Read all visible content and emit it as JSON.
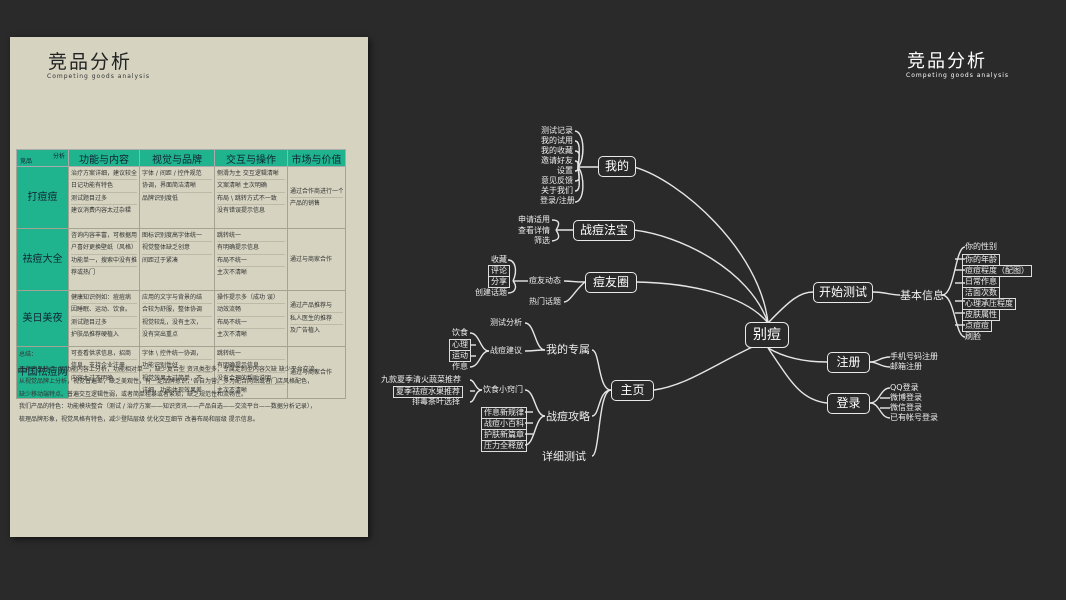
{
  "doc": {
    "title": "竞品分析",
    "subtitle": "Competing goods analysis",
    "table": {
      "corner_top": "分析",
      "corner_bottom": "竞品",
      "headers": [
        "功能与内容",
        "视觉与品牌",
        "交互与操作",
        "市场与价值"
      ],
      "rows": [
        {
          "name": "打痘痘",
          "c1": [
            "治疗方案详细，建议较全",
            "日记功能有特色",
            "测试题目过多",
            "建议消费内容太过杂糅"
          ],
          "c2": [
            "字体 / 间距 / 控件规范",
            "协调，界面简洁清晰",
            "品牌识别度低"
          ],
          "c3": [
            "侧滑为主 交互逻辑清晰",
            "文案清晰 主次明确",
            "布局 \\ 跳转方式不一致",
            "没有错误提示信息"
          ],
          "c4": [
            "通过合作商进行一个",
            "产品的销售"
          ]
        },
        {
          "name": "祛痘大全",
          "c1": [
            "咨询内容丰富，可根据用",
            "户喜好更换壁纸（风格）",
            "功能单一，搜索中没有推",
            "荐或热门"
          ],
          "c2": [
            "图标识别度高字体统一",
            "视觉整体缺乏创意",
            "间距过于紧凑"
          ],
          "c3": [
            "跳转统一",
            "有明确提示信息",
            "布局不统一",
            "主次不清晰"
          ],
          "c4": [
            "通过与商家合作"
          ]
        },
        {
          "name": "美日美夜",
          "c1": [
            "健康知识例如：痘痘病",
            "因睡眠、运动、饮食。",
            "测试题目过多",
            "护肤品推荐硬植入"
          ],
          "c2": [
            "应用的文字与背景的结",
            "合较为舒服，整体协调",
            "视觉较乱，没有主次，",
            "没有突出重点"
          ],
          "c3": [
            "操作提示多（成功 误）",
            "动效流畅",
            "布局不统一",
            "主次不清晰"
          ],
          "c4": [
            "通过产品推荐与",
            "私人医生的推荐",
            "及广告植入"
          ]
        },
        {
          "name": "中国祛痘网",
          "c1": [
            "可查看供求信息，招商",
            "信息，支持企业注册",
            "内容太过不明确"
          ],
          "c2": [
            "字体 \\ 控件统一协调，",
            "功能识别性好",
            "视觉效果太过简单，不",
            "详细，功能体现效果差"
          ],
          "c3": [
            "跳转统一",
            "有明确提示信息",
            "没有合理的帮助说明",
            "主次不清晰"
          ],
          "c4": [
            "通过与商家合作"
          ]
        }
      ]
    },
    "summary": [
      "总结：",
      "现有产品特点: 从功能内容上分析，功能相对单一，缺少复合型 资讯类型多，专属定制型内容欠缺 缺少平台交流。",
      "从视觉品牌上分析，视觉普遍差，缺乏美观性，有一定品牌意识，各自为营。多为配合网站或者门店风格配色，",
      "缺少移动端特点。普遍交互逻辑性弱，或者简单粗暴或者繁琐，缺乏规范性和流畅性。",
      "我们产品的特色：功能模块整合（测试 / 治疗方案——知识资讯——产品自选——交流平台——数据分析记录），",
      "梳理品牌形象，视觉风格有特色，减少登陆层级  优化交互细节  改善布局和层级  提示信息。"
    ]
  },
  "mindmap": {
    "title": "竞品分析",
    "subtitle": "Competing goods analysis",
    "center": "别痘",
    "nodes": {
      "mine": "我的",
      "fabao": "战痘法宝",
      "circle": "痘友圈",
      "test": "开始测试",
      "register": "注册",
      "login": "登录",
      "home": "主页"
    },
    "mine_items": [
      "测试记录",
      "我的试用",
      "我的收藏",
      "邀请好友",
      "设置",
      "意见反馈",
      "关于我们",
      "登录/注册"
    ],
    "fabao_items": [
      "申请适用",
      "查看详情",
      "筛选"
    ],
    "circle_dynamic": "痘友动态",
    "circle_dynamic_items": [
      "收藏",
      "评论",
      "分享",
      "创建话题"
    ],
    "circle_hot": "热门话题",
    "test_basic": "基本信息",
    "test_items": [
      "你的性别",
      "你的年龄",
      "痘痘程度（配图）",
      "日常作息",
      "洁面次数",
      "心理承压程度",
      "皮肤属性",
      "点痘痘",
      "刷脸"
    ],
    "register_items": [
      "手机号码注册",
      "邮箱注册"
    ],
    "login_items": [
      "QQ登录",
      "微博登录",
      "微信登录",
      "已有帐号登录"
    ],
    "home_zone": "我的专属",
    "home_zone_test": "测试分析",
    "home_zone_suggest": "战痘建议",
    "home_zone_suggest_items": [
      "饮食",
      "心理",
      "运动",
      "作息"
    ],
    "home_strategy": "战痘攻略",
    "home_strategy_items": [
      "饮食小窍门",
      "作息新规律",
      "战痘小百科",
      "护肤新篇章",
      "压力全释放"
    ],
    "home_diet_items": [
      "九款夏季清火蔬菜推荐",
      "夏季祛痘水果推荐",
      "排毒茶叶选择"
    ],
    "home_detail_test": "详细测试"
  }
}
